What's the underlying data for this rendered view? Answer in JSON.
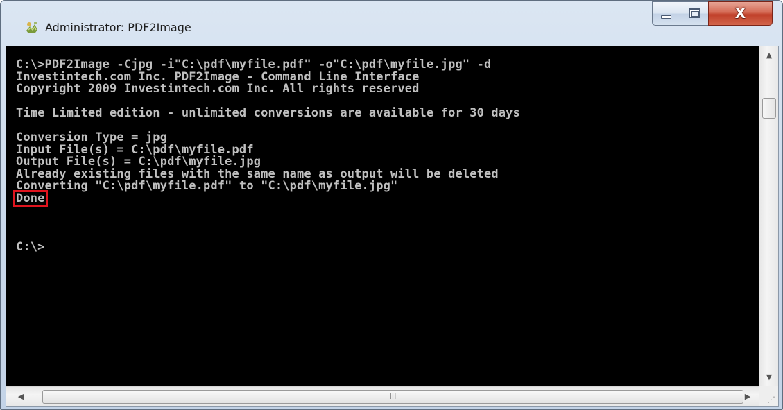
{
  "window": {
    "title": "Administrator: PDF2Image",
    "close_glyph": "X"
  },
  "console": {
    "lines": [
      "C:\\>PDF2Image -Cjpg -i\"C:\\pdf\\myfile.pdf\" -o\"C:\\pdf\\myfile.jpg\" -d",
      "Investintech.com Inc. PDF2Image - Command Line Interface",
      "Copyright 2009 Investintech.com Inc. All rights reserved",
      "",
      "Time Limited edition - unlimited conversions are available for 30 days",
      "",
      "Conversion Type = jpg",
      "Input File(s) = C:\\pdf\\myfile.pdf",
      "Output File(s) = C:\\pdf\\myfile.jpg",
      "Already existing files with the same name as output will be deleted",
      "Converting \"C:\\pdf\\myfile.pdf\" to \"C:\\pdf\\myfile.jpg\"",
      "Done",
      "",
      "",
      "",
      "C:\\>"
    ],
    "highlighted_line_index": 11,
    "highlight_color": "#e0141e",
    "text_color": "#c0c0c0",
    "background_color": "#000000"
  },
  "scrollbars": {
    "horizontal_thumb_grip": "III",
    "up_arrow": "▲",
    "down_arrow": "▼",
    "left_arrow": "◀",
    "right_arrow": "▶"
  }
}
